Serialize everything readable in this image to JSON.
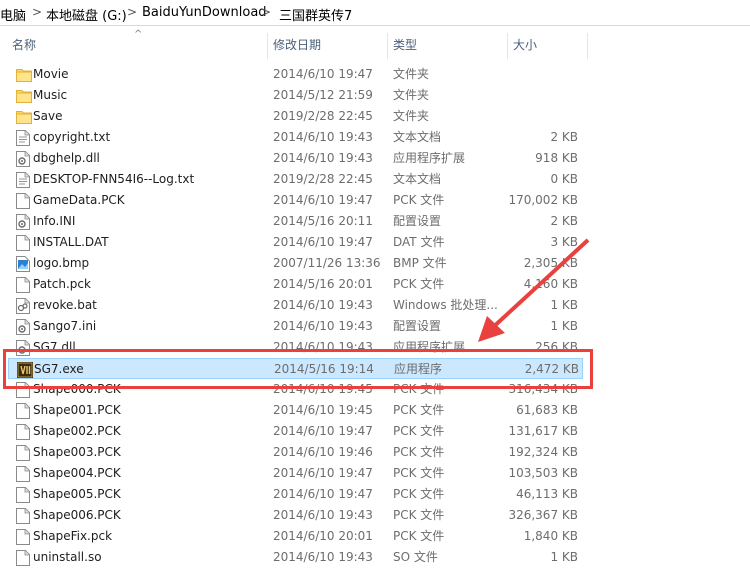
{
  "breadcrumb": {
    "items": [
      "电脑",
      "本地磁盘 (G:)",
      "BaiduYunDownload",
      "三国群英传7"
    ],
    "separator": ">"
  },
  "columns": {
    "name": "名称",
    "date": "修改日期",
    "type": "类型",
    "size": "大小"
  },
  "files": [
    {
      "name": "Movie",
      "date": "2014/6/10 19:47",
      "type": "文件夹",
      "size": "",
      "icon": "folder-icon"
    },
    {
      "name": "Music",
      "date": "2014/5/12 21:59",
      "type": "文件夹",
      "size": "",
      "icon": "folder-icon"
    },
    {
      "name": "Save",
      "date": "2019/2/28 22:45",
      "type": "文件夹",
      "size": "",
      "icon": "folder-icon"
    },
    {
      "name": "copyright.txt",
      "date": "2014/6/10 19:43",
      "type": "文本文档",
      "size": "2 KB",
      "icon": "text-file-icon"
    },
    {
      "name": "dbghelp.dll",
      "date": "2014/6/10 19:43",
      "type": "应用程序扩展",
      "size": "918 KB",
      "icon": "dll-file-icon"
    },
    {
      "name": "DESKTOP-FNN54I6--Log.txt",
      "date": "2019/2/28 22:45",
      "type": "文本文档",
      "size": "0 KB",
      "icon": "text-file-icon"
    },
    {
      "name": "GameData.PCK",
      "date": "2014/6/10 19:47",
      "type": "PCK 文件",
      "size": "170,002 KB",
      "icon": "blank-file-icon"
    },
    {
      "name": "Info.INI",
      "date": "2014/5/16 20:11",
      "type": "配置设置",
      "size": "2 KB",
      "icon": "ini-file-icon"
    },
    {
      "name": "INSTALL.DAT",
      "date": "2014/6/10 19:47",
      "type": "DAT 文件",
      "size": "3 KB",
      "icon": "blank-file-icon"
    },
    {
      "name": "logo.bmp",
      "date": "2007/11/26 13:36",
      "type": "BMP 文件",
      "size": "2,305 KB",
      "icon": "image-file-icon"
    },
    {
      "name": "Patch.pck",
      "date": "2014/5/16 20:01",
      "type": "PCK 文件",
      "size": "4,160 KB",
      "icon": "blank-file-icon"
    },
    {
      "name": "revoke.bat",
      "date": "2014/6/10 19:43",
      "type": "Windows 批处理...",
      "size": "1 KB",
      "icon": "batch-file-icon"
    },
    {
      "name": "Sango7.ini",
      "date": "2014/6/10 19:43",
      "type": "配置设置",
      "size": "1 KB",
      "icon": "ini-file-icon"
    },
    {
      "name": "SG7.dll",
      "date": "2014/6/10 19:43",
      "type": "应用程序扩展",
      "size": "256 KB",
      "icon": "dll-file-icon"
    },
    {
      "name": "SG7.exe",
      "date": "2014/5/16 19:14",
      "type": "应用程序",
      "size": "2,472 KB",
      "icon": "sg7-app-icon",
      "selected": true
    },
    {
      "name": "Shape000.PCK",
      "date": "2014/6/10 19:45",
      "type": "PCK 文件",
      "size": "316,434 KB",
      "icon": "blank-file-icon"
    },
    {
      "name": "Shape001.PCK",
      "date": "2014/6/10 19:45",
      "type": "PCK 文件",
      "size": "61,683 KB",
      "icon": "blank-file-icon"
    },
    {
      "name": "Shape002.PCK",
      "date": "2014/6/10 19:47",
      "type": "PCK 文件",
      "size": "131,617 KB",
      "icon": "blank-file-icon"
    },
    {
      "name": "Shape003.PCK",
      "date": "2014/6/10 19:46",
      "type": "PCK 文件",
      "size": "192,324 KB",
      "icon": "blank-file-icon"
    },
    {
      "name": "Shape004.PCK",
      "date": "2014/6/10 19:47",
      "type": "PCK 文件",
      "size": "103,503 KB",
      "icon": "blank-file-icon"
    },
    {
      "name": "Shape005.PCK",
      "date": "2014/6/10 19:47",
      "type": "PCK 文件",
      "size": "46,113 KB",
      "icon": "blank-file-icon"
    },
    {
      "name": "Shape006.PCK",
      "date": "2014/6/10 19:43",
      "type": "PCK 文件",
      "size": "326,367 KB",
      "icon": "blank-file-icon"
    },
    {
      "name": "ShapeFix.pck",
      "date": "2014/6/10 20:01",
      "type": "PCK 文件",
      "size": "1,840 KB",
      "icon": "blank-file-icon"
    },
    {
      "name": "uninstall.so",
      "date": "2014/6/10 19:43",
      "type": "SO 文件",
      "size": "1 KB",
      "icon": "blank-file-icon"
    }
  ],
  "colors": {
    "selection_bg": "#cce8ff",
    "annotation_red": "#e8413e",
    "folder_yellow": "#ffd562"
  }
}
